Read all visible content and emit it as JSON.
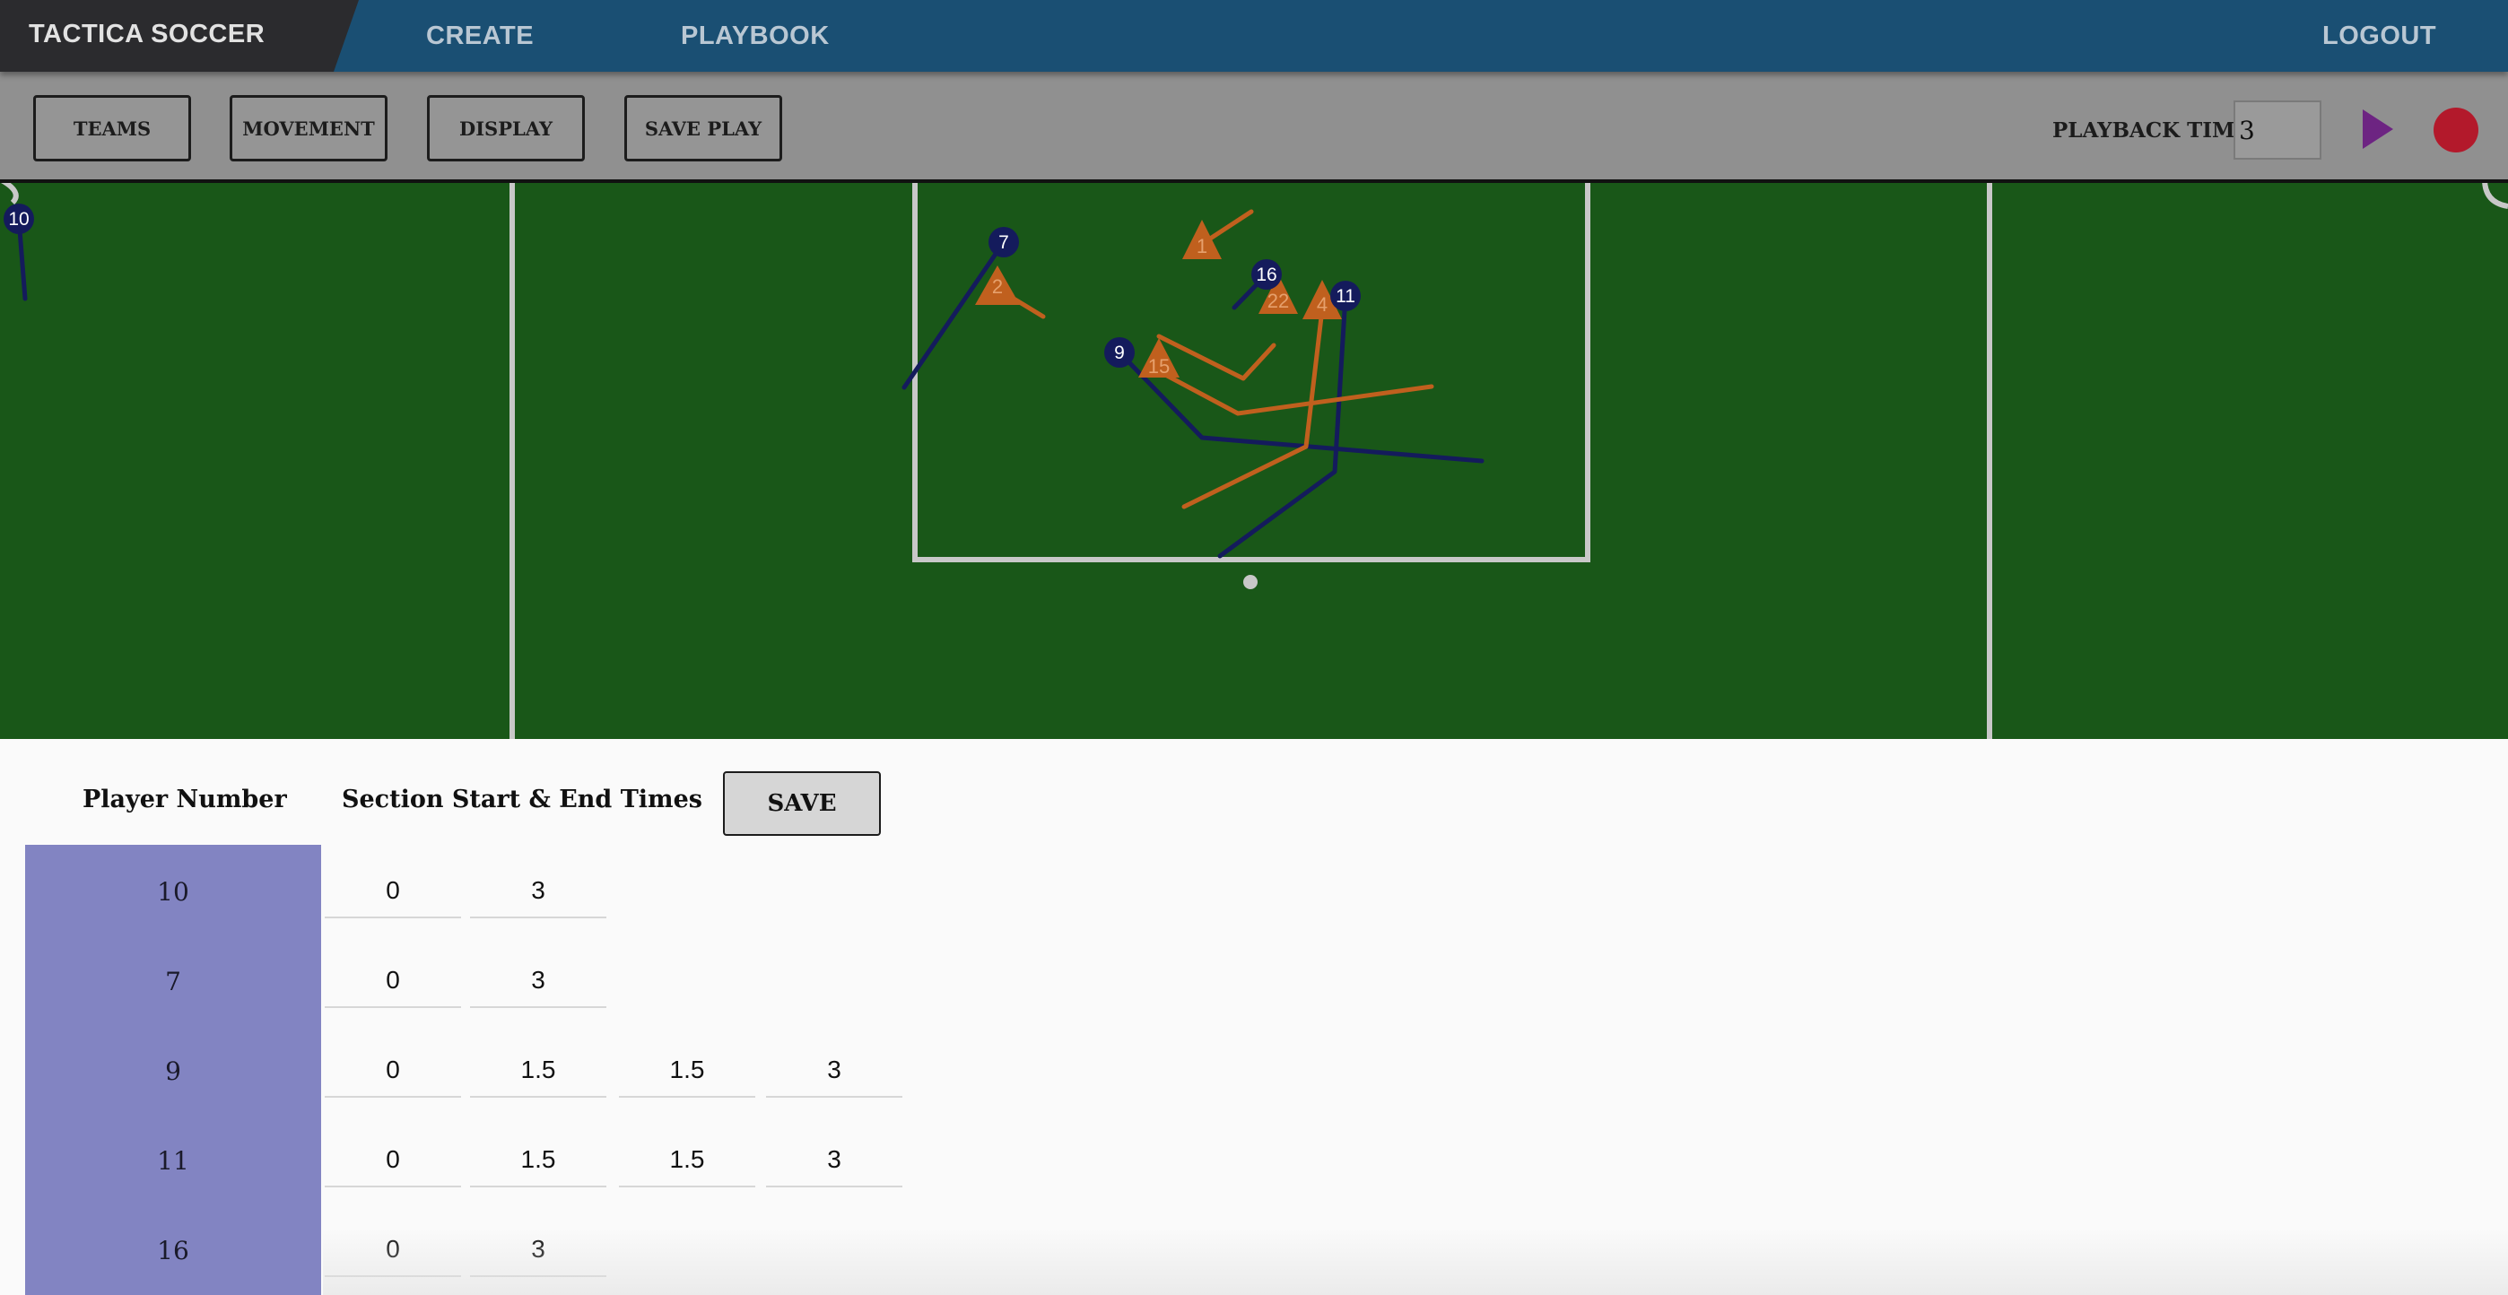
{
  "nav": {
    "brand": "TACTICA SOCCER",
    "create": "CREATE",
    "playbook": "PLAYBOOK",
    "logout": "LOGOUT"
  },
  "toolbar": {
    "teams": "TEAMS",
    "movement": "MOVEMENT",
    "display": "DISPLAY",
    "save_play": "SAVE PLAY",
    "playback_label": "PLAYBACK TIME:",
    "playback_value": "3",
    "play_icon": "play-icon",
    "record_icon": "record-icon"
  },
  "colors": {
    "field": "#195718",
    "lines": "#c8c8c8",
    "blue_team": "#141b5c",
    "orange_team": "#c0601e",
    "player_column": "#8284c2",
    "play": "#6d2482",
    "record": "#b3192b"
  },
  "field": {
    "blue_players": [
      "10",
      "7",
      "9",
      "16",
      "11"
    ],
    "orange_players": [
      "1",
      "2",
      "22",
      "4",
      "15"
    ]
  },
  "panel": {
    "player_header": "Player Number",
    "times_header": "Section Start & End Times",
    "save": "SAVE",
    "rows": [
      {
        "player": "10",
        "times": [
          "0",
          "3"
        ]
      },
      {
        "player": "7",
        "times": [
          "0",
          "3"
        ]
      },
      {
        "player": "9",
        "times": [
          "0",
          "1.5",
          "1.5",
          "3"
        ]
      },
      {
        "player": "11",
        "times": [
          "0",
          "1.5",
          "1.5",
          "3"
        ]
      },
      {
        "player": "16",
        "times": [
          "0",
          "3"
        ]
      }
    ]
  }
}
